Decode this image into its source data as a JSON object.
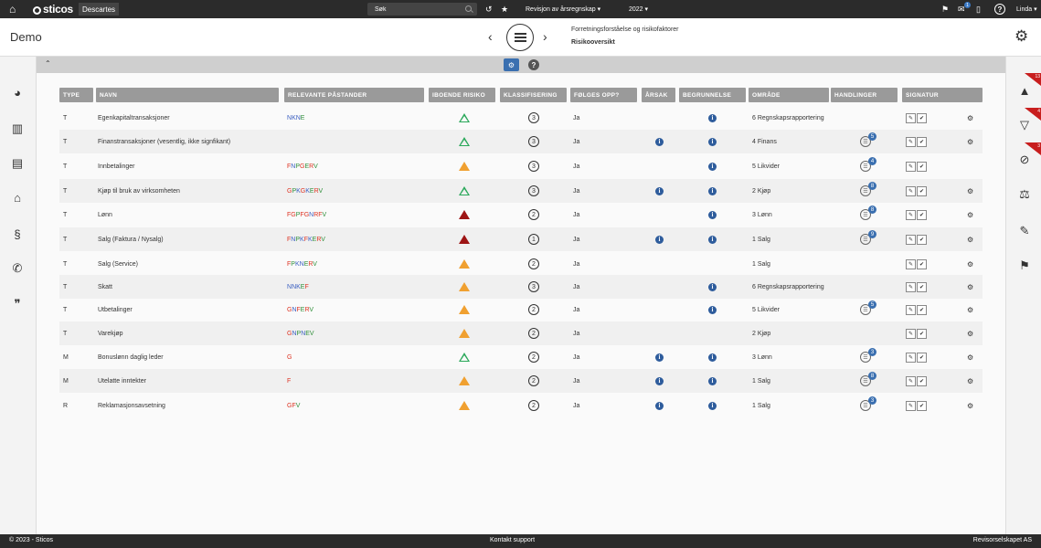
{
  "topbar": {
    "app_name": "Descartes",
    "logo_text": "sticos",
    "search_placeholder": "Søk",
    "menu_revision": "Revisjon av årsregnskap ▾",
    "menu_year": "2022 ▾",
    "inbox_badge": "1",
    "help": "?",
    "user": "Linda ▾"
  },
  "header": {
    "title": "Demo",
    "breadcrumb_parent": "Forretningsforståelse og risikofaktorer",
    "breadcrumb_current": "Risikooversikt"
  },
  "rightbar": {
    "badges": [
      "13",
      "4",
      "3"
    ]
  },
  "table": {
    "headers": [
      "TYPE",
      "NAVN",
      "RELEVANTE PÅSTANDER",
      "IBOENDE RISIKO",
      "KLASSIFISERING",
      "FØLGES OPP?",
      "ÅRSAK",
      "BEGRUNNELSE",
      "OMRÅDE",
      "HANDLINGER",
      "SIGNATUR"
    ],
    "rows": [
      {
        "type": "T",
        "name": "Egenkapitaltransaksjoner",
        "pa": "NKNE",
        "risk": "green",
        "klass": "3",
        "folges": "Ja",
        "arsak": false,
        "begr": true,
        "omrade": "6 Regnskapsrapportering",
        "hand": "",
        "cog": true
      },
      {
        "type": "T",
        "name": "Finanstransaksjoner (vesentlig, ikke signfikant)",
        "pa": "",
        "risk": "green",
        "klass": "3",
        "folges": "Ja",
        "arsak": true,
        "begr": true,
        "omrade": "4 Finans",
        "hand": "5",
        "cog": true
      },
      {
        "type": "T",
        "name": "Innbetalinger",
        "pa": "FNPGERV",
        "risk": "orange",
        "klass": "3",
        "folges": "Ja",
        "arsak": false,
        "begr": true,
        "omrade": "5 Likvider",
        "hand": "4",
        "cog": false
      },
      {
        "type": "T",
        "name": "Kjøp til bruk av virksomheten",
        "pa": "GPKGKERV",
        "risk": "green",
        "klass": "3",
        "folges": "Ja",
        "arsak": true,
        "begr": true,
        "omrade": "2 Kjøp",
        "hand": "8",
        "cog": true
      },
      {
        "type": "T",
        "name": "Lønn",
        "pa": "FGPFGNRFV",
        "risk": "red",
        "klass": "2",
        "folges": "Ja",
        "arsak": false,
        "begr": true,
        "omrade": "3 Lønn",
        "hand": "8",
        "cog": true
      },
      {
        "type": "T",
        "name": "Salg (Faktura / Nysalg)",
        "pa": "FNPKFKERV",
        "risk": "red",
        "klass": "1",
        "folges": "Ja",
        "arsak": true,
        "begr": true,
        "omrade": "1 Salg",
        "hand": "9",
        "cog": true
      },
      {
        "type": "T",
        "name": "Salg (Service)",
        "pa": "FPKNERV",
        "risk": "orange",
        "klass": "2",
        "folges": "Ja",
        "arsak": false,
        "begr": false,
        "omrade": "1 Salg",
        "hand": "",
        "cog": true
      },
      {
        "type": "T",
        "name": "Skatt",
        "pa": "NNKEF",
        "risk": "orange",
        "klass": "3",
        "folges": "Ja",
        "arsak": false,
        "begr": true,
        "omrade": "6 Regnskapsrapportering",
        "hand": "",
        "cog": true
      },
      {
        "type": "T",
        "name": "Utbetalinger",
        "pa": "GNFERV",
        "risk": "orange",
        "klass": "2",
        "folges": "Ja",
        "arsak": false,
        "begr": true,
        "omrade": "5 Likvider",
        "hand": "5",
        "cog": true
      },
      {
        "type": "T",
        "name": "Varekjøp",
        "pa": "GNPNEV",
        "risk": "orange",
        "klass": "2",
        "folges": "Ja",
        "arsak": false,
        "begr": false,
        "omrade": "2 Kjøp",
        "hand": "",
        "cog": true
      },
      {
        "type": "M",
        "name": "Bonuslønn daglig leder",
        "pa": "G",
        "risk": "green",
        "klass": "2",
        "folges": "Ja",
        "arsak": true,
        "begr": true,
        "omrade": "3 Lønn",
        "hand": "3",
        "cog": true
      },
      {
        "type": "M",
        "name": "Utelatte inntekter",
        "pa": "F",
        "risk": "orange",
        "klass": "2",
        "folges": "Ja",
        "arsak": true,
        "begr": true,
        "omrade": "1 Salg",
        "hand": "8",
        "cog": true
      },
      {
        "type": "R",
        "name": "Reklamasjonsavsetning",
        "pa": "GFV",
        "risk": "orange",
        "klass": "2",
        "folges": "Ja",
        "arsak": true,
        "begr": true,
        "omrade": "1 Salg",
        "hand": "3",
        "cog": true
      }
    ]
  },
  "colors": {
    "red": "#9e1515",
    "orange": "#f0a030",
    "green": "#2aa85a"
  },
  "footer": {
    "copyright": "© 2023 - Sticos",
    "support": "Kontakt support",
    "company": "Revisorselskapet AS"
  }
}
